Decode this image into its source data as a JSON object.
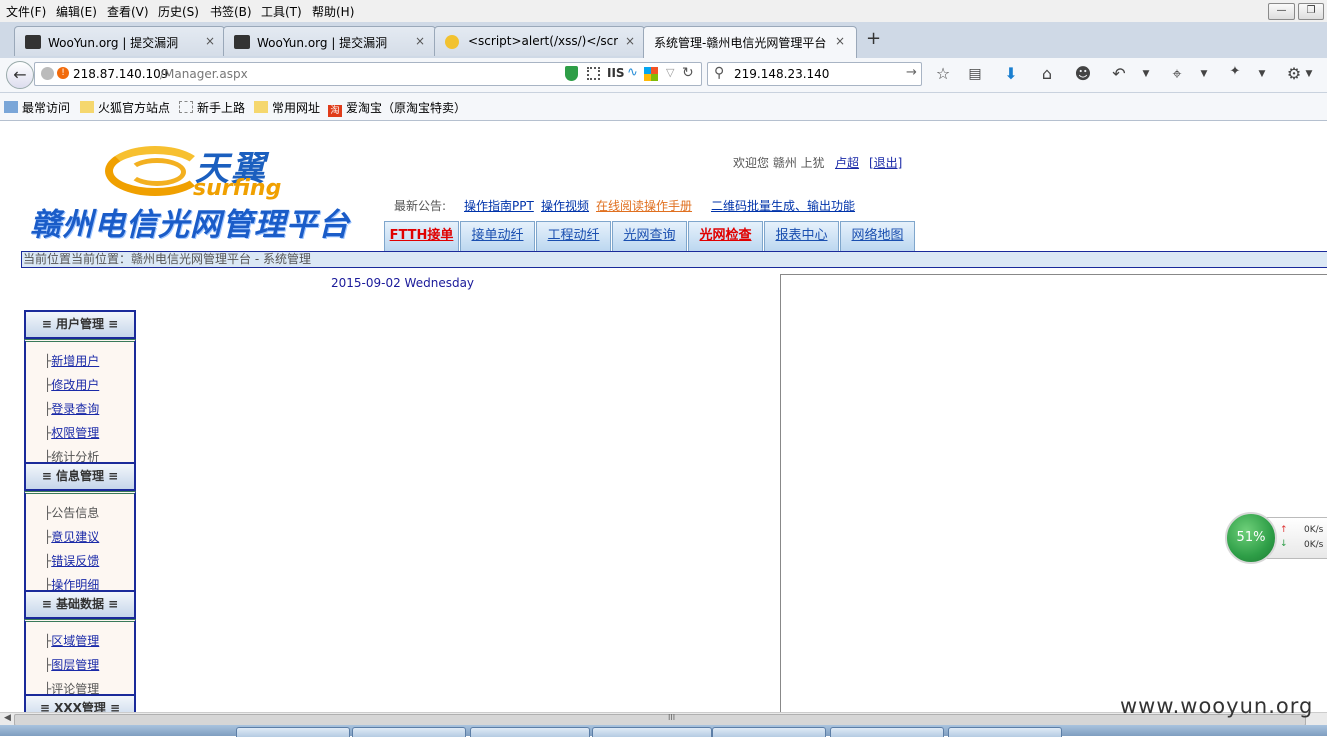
{
  "browser": {
    "menu": [
      "文件(F)",
      "编辑(E)",
      "查看(V)",
      "历史(S)",
      "书签(B)",
      "工具(T)",
      "帮助(H)"
    ],
    "tabs": [
      {
        "title": "WooYun.org | 提交漏洞"
      },
      {
        "title": "WooYun.org | 提交漏洞"
      },
      {
        "title": "<script>alert(/xss/)</scr..."
      },
      {
        "title": "系统管理-赣州电信光网管理平台"
      }
    ],
    "new_tab": "+",
    "close_glyph": "×",
    "url": "218.87.140.109/Manager.aspx",
    "url_host": "218.87.140.109",
    "url_path": "/Manager.aspx",
    "iis_badge": "IIS",
    "search_value": "219.148.23.140",
    "bookmarks": [
      "最常访问",
      "火狐官方站点",
      "新手上路",
      "常用网址",
      "爱淘宝（原淘宝特卖）"
    ],
    "taobao_glyph": "淘",
    "icons": [
      "back-icon",
      "info-icon",
      "shield-icon",
      "qr-icon",
      "reload-icon",
      "search-icon",
      "star-icon",
      "reader-icon",
      "download-icon",
      "home-icon",
      "chat-icon",
      "undo-icon",
      "crop-icon",
      "gesture-icon",
      "menu-icon"
    ]
  },
  "page": {
    "logo_brand": "天翼",
    "logo_sub": "surfing",
    "site_name": "赣州电信光网管理平台",
    "welcome_prefix": "欢迎您 赣州 上犹",
    "user": "卢超",
    "logout": "[退出]",
    "notice_label": "最新公告:",
    "notices": [
      {
        "text": "操作指南PPT",
        "color": "#0033aa"
      },
      {
        "text": "操作视频",
        "color": "#0033aa"
      },
      {
        "text": "在线阅读操作手册",
        "color": "#e07020"
      },
      {
        "text": "二维码批量生成、输出功能",
        "color": "#0033aa"
      }
    ],
    "nav_tabs": [
      {
        "label": "FTTH接单",
        "style": "red"
      },
      {
        "label": "接单动纤",
        "style": "blue"
      },
      {
        "label": "工程动纤",
        "style": "blue"
      },
      {
        "label": "光网查询",
        "style": "blue"
      },
      {
        "label": "光网检查",
        "style": "red"
      },
      {
        "label": "报表中心",
        "style": "blue"
      },
      {
        "label": "网络地图",
        "style": "blue"
      }
    ],
    "breadcrumb": "当前位置当前位置：赣州电信光网管理平台 - 系统管理",
    "date": "2015-09-02 Wednesday",
    "sidebar": [
      {
        "title": "≡ 用户管理 ≡",
        "items": [
          {
            "label": "新增用户",
            "link": true
          },
          {
            "label": "修改用户",
            "link": true
          },
          {
            "label": "登录查询",
            "link": true
          },
          {
            "label": "权限管理",
            "link": true
          },
          {
            "label": "统计分析",
            "link": false
          }
        ]
      },
      {
        "title": "≡ 信息管理 ≡",
        "items": [
          {
            "label": "公告信息",
            "link": false
          },
          {
            "label": "意见建议",
            "link": true
          },
          {
            "label": "错误反馈",
            "link": true
          },
          {
            "label": "操作明细",
            "link": true
          }
        ]
      },
      {
        "title": "≡ 基础数据 ≡",
        "items": [
          {
            "label": "区域管理",
            "link": true
          },
          {
            "label": "图层管理",
            "link": true
          },
          {
            "label": "评论管理",
            "link": false
          }
        ]
      },
      {
        "title": "≡ XXX管理 ≡",
        "items": []
      }
    ],
    "item_prefix": "├"
  },
  "overlay": {
    "speed_percent": "51%",
    "upload": "0K/s",
    "download": "0K/s",
    "up_arrow": "↑",
    "down_arrow": "↓"
  },
  "watermark": "www.wooyun.org",
  "scroll_grip": "III",
  "colors": {
    "accent": "#1a2a9a",
    "brand_blue": "#1a5cc8",
    "brand_orange": "#f0a000",
    "speed_green": "#2e9e47"
  }
}
